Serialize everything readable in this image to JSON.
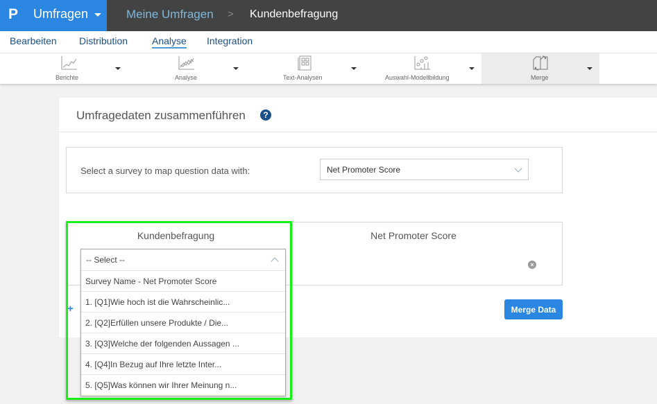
{
  "topbar": {
    "logo_glyph": "P",
    "app_name": "Umfragen",
    "breadcrumb": [
      "Meine Umfragen",
      "Kundenbefragung"
    ],
    "breadcrumb_separator": ">"
  },
  "nav": {
    "tabs": [
      {
        "label": "Bearbeiten",
        "active": false
      },
      {
        "label": "Distribution",
        "active": false
      },
      {
        "label": "Analyse",
        "active": true
      },
      {
        "label": "Integration",
        "active": false
      }
    ]
  },
  "toolbar": {
    "items": [
      {
        "label": "Berichte",
        "icon": "line-chart-icon",
        "active": false
      },
      {
        "label": "Analyse",
        "icon": "multi-line-chart-icon",
        "active": false
      },
      {
        "label": "Text-Analysen",
        "icon": "text-document-icon",
        "active": false
      },
      {
        "label": "Auswahl-Modellbildung",
        "icon": "scatter-bar-icon",
        "active": false
      },
      {
        "label": "Merge",
        "icon": "merge-documents-icon",
        "active": true
      }
    ]
  },
  "panel": {
    "title": "Umfragedaten zusammenführen",
    "help_glyph": "?",
    "survey_select_label": "Select a survey to map question data with:",
    "survey_select_value": "Net Promoter Score",
    "left_column_header": "Kundenbefragung",
    "right_column_header": "Net Promoter Score",
    "remove_glyph": "×",
    "add_glyph": "+",
    "merge_button": "Merge Data"
  },
  "dropdown": {
    "selected": "-- Select --",
    "options": [
      "Survey Name - Net Promoter Score",
      "1. [Q1]Wie hoch ist die Wahrscheinlic...",
      "2. [Q2]Erfüllen unsere Produkte / Die...",
      "3. [Q3]Welche der folgenden Aussagen ...",
      "4. [Q4]In Bezug auf Ihre letzte Inter...",
      "5. [Q5]Was können wir Ihrer Meinung n..."
    ]
  },
  "colors": {
    "brand": "#2a86e0",
    "topbar": "#434343",
    "nav_text": "#1a4f8a",
    "highlight": "#18f018"
  }
}
